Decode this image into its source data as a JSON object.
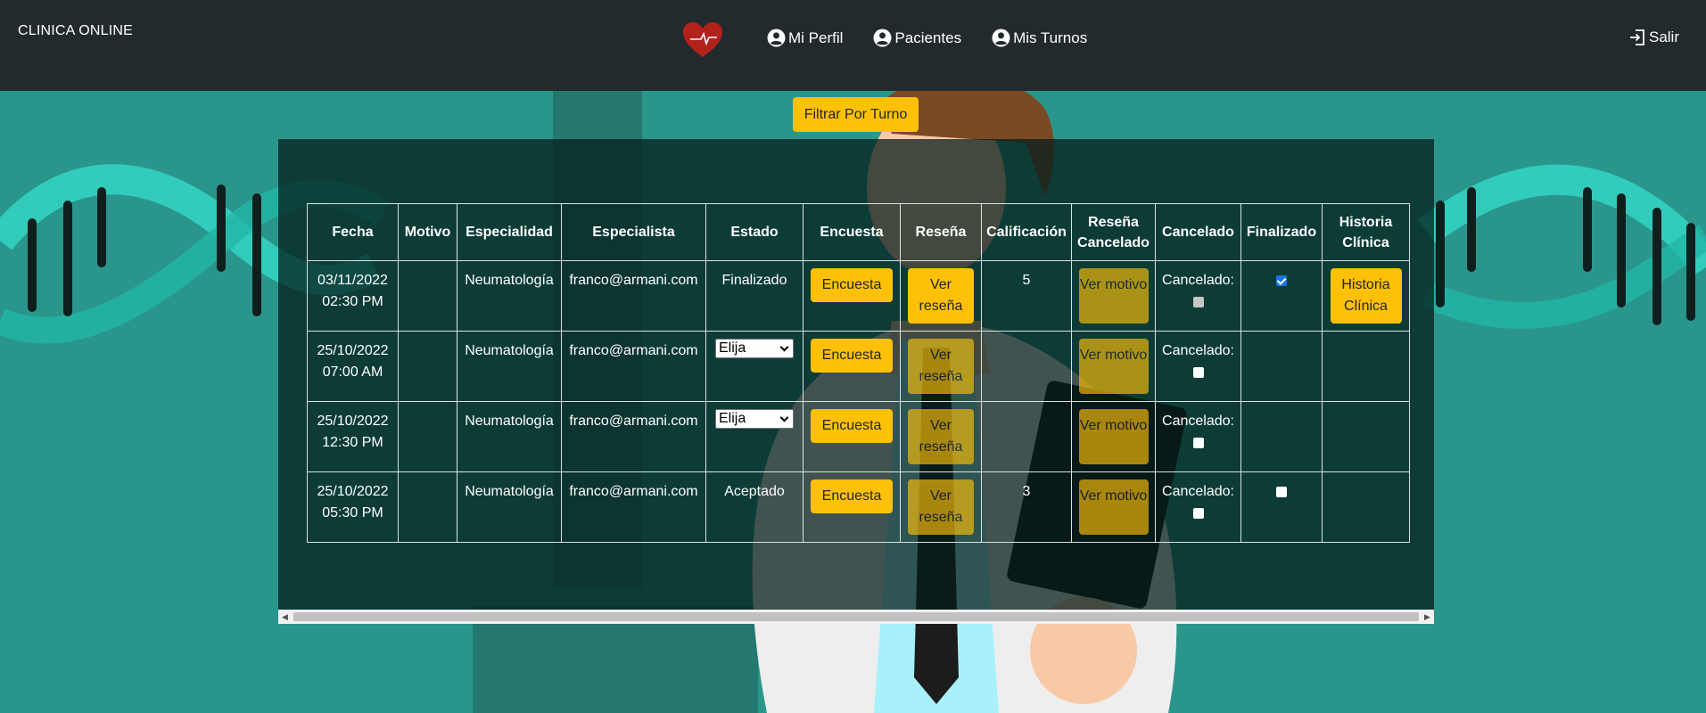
{
  "app": {
    "brand": "CLINICA ONLINE",
    "logo_icon": "heart-pulse-icon",
    "accent": "#ffc107",
    "navbar_bg": "#222a2e"
  },
  "nav": {
    "items": [
      {
        "label": "Mi Perfil",
        "icon": "user-circle-icon"
      },
      {
        "label": "Pacientes",
        "icon": "user-circle-icon"
      },
      {
        "label": "Mis Turnos",
        "icon": "user-circle-icon"
      }
    ],
    "logout": {
      "label": "Salir",
      "icon": "logout-icon"
    }
  },
  "filter_button": "Filtrar Por Turno",
  "table": {
    "headers": [
      "Fecha",
      "Motivo",
      "Especialidad",
      "Especialista",
      "Estado",
      "Encuesta",
      "Reseña",
      "Calificación",
      "Reseña Cancelado",
      "Cancelado",
      "Finalizado",
      "Historia Clínica"
    ],
    "rows": [
      {
        "date": "03/11/2022",
        "time": "02:30 PM",
        "motivo": "",
        "especialidad": "Neumatología",
        "especialista": "franco@armani.com",
        "estado": "Finalizado",
        "estado_select": false,
        "encuesta": "Encuesta",
        "resena": "Ver reseña",
        "resena_enabled": true,
        "calificacion": "5",
        "resena_cancelado": "Ver motivo",
        "cancelado_label": "Cancelado:",
        "cancelado_checked": false,
        "cancelado_disabled": true,
        "finalizado": "checked",
        "historia": "Historia Clínica"
      },
      {
        "date": "25/10/2022",
        "time": "07:00 AM",
        "motivo": "",
        "especialidad": "Neumatología",
        "especialista": "franco@armani.com",
        "estado": "Elija",
        "estado_select": true,
        "encuesta": "Encuesta",
        "resena": "Ver reseña",
        "resena_enabled": false,
        "calificacion": "",
        "resena_cancelado": "Ver motivo",
        "cancelado_label": "Cancelado:",
        "cancelado_checked": false,
        "cancelado_disabled": false,
        "finalizado": "none",
        "historia": ""
      },
      {
        "date": "25/10/2022",
        "time": "12:30 PM",
        "motivo": "",
        "especialidad": "Neumatología",
        "especialista": "franco@armani.com",
        "estado": "Elija",
        "estado_select": true,
        "encuesta": "Encuesta",
        "resena": "Ver reseña",
        "resena_enabled": false,
        "calificacion": "",
        "resena_cancelado": "Ver motivo",
        "cancelado_label": "Cancelado:",
        "cancelado_checked": false,
        "cancelado_disabled": false,
        "finalizado": "none",
        "historia": ""
      },
      {
        "date": "25/10/2022",
        "time": "05:30 PM",
        "motivo": "",
        "especialidad": "Neumatología",
        "especialista": "franco@armani.com",
        "estado": "Aceptado",
        "estado_select": false,
        "encuesta": "Encuesta",
        "resena": "Ver reseña",
        "resena_enabled": false,
        "calificacion": "3",
        "resena_cancelado": "Ver motivo",
        "cancelado_label": "Cancelado:",
        "cancelado_checked": false,
        "cancelado_disabled": false,
        "finalizado": "unchecked",
        "historia": ""
      }
    ]
  },
  "scrollbar": {
    "left_arrow": "◀",
    "right_arrow": "▶"
  }
}
